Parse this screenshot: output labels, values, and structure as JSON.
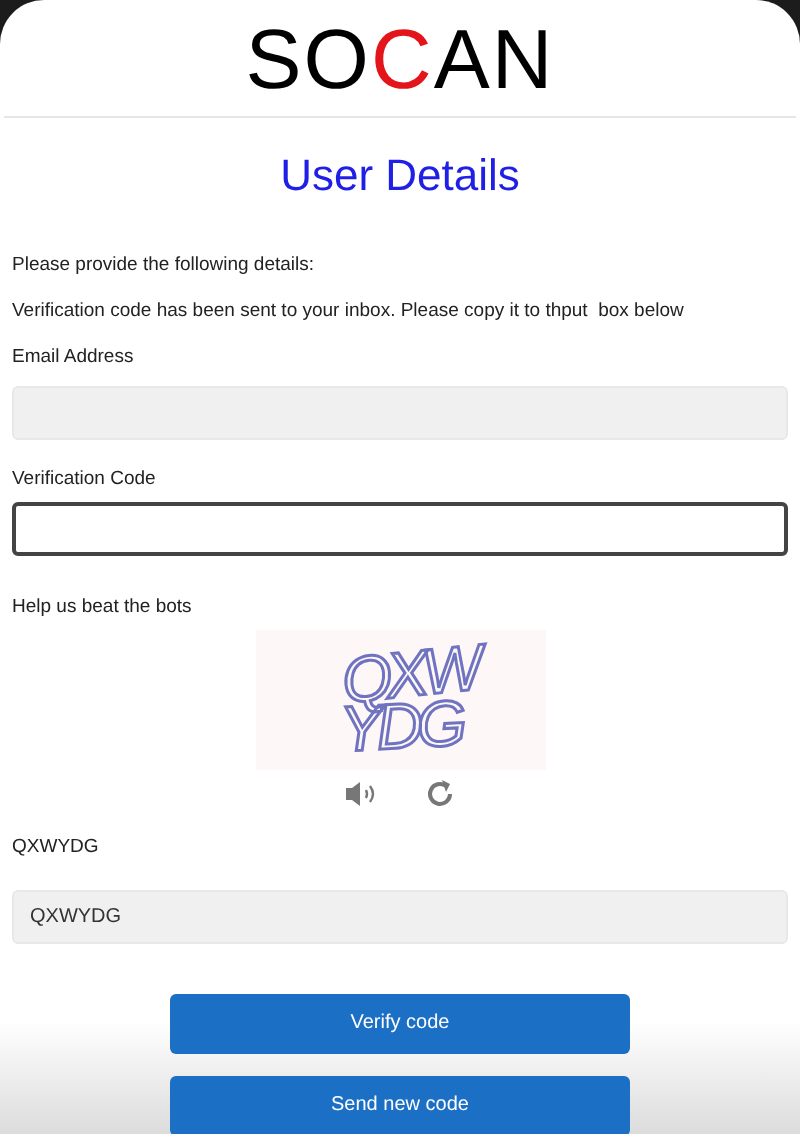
{
  "logo": [
    {
      "text": "SO",
      "accent": false
    },
    {
      "text": "C",
      "accent": true
    },
    {
      "text": "AN",
      "accent": false
    }
  ],
  "title": "User Details",
  "intro": "Please provide the following details:",
  "notice": "Verification code has been sent to your inbox. Please copy it to thput  box below",
  "email": {
    "label": "Email Address",
    "disabled": true
  },
  "code": {
    "label": "Verification Code",
    "disabled": false
  },
  "captcha": {
    "label": "Help us beat the bots",
    "lines": [
      "QXW",
      "YDG"
    ]
  },
  "answer": {
    "label": "QXWYDG",
    "value": "QXWYDG",
    "disabled": true
  },
  "buttons": [
    "Verify code",
    "Send new code"
  ]
}
